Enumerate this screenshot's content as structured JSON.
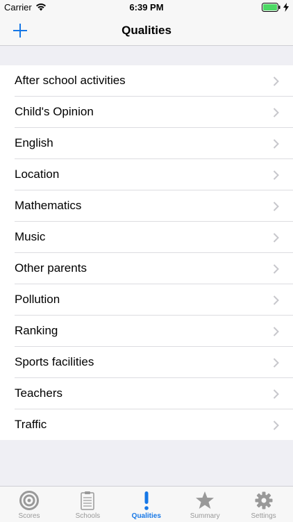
{
  "status_bar": {
    "carrier": "Carrier",
    "time": "6:39 PM"
  },
  "nav": {
    "title": "Qualities",
    "add_icon": "plus-icon"
  },
  "qualities": [
    {
      "label": "After school activities"
    },
    {
      "label": "Child's Opinion"
    },
    {
      "label": "English"
    },
    {
      "label": "Location"
    },
    {
      "label": "Mathematics"
    },
    {
      "label": "Music"
    },
    {
      "label": "Other parents"
    },
    {
      "label": "Pollution"
    },
    {
      "label": "Ranking"
    },
    {
      "label": "Sports facilities"
    },
    {
      "label": "Teachers"
    },
    {
      "label": "Traffic"
    }
  ],
  "tabs": [
    {
      "label": "Scores",
      "icon": "target-icon",
      "selected": false
    },
    {
      "label": "Schools",
      "icon": "clipboard-icon",
      "selected": false
    },
    {
      "label": "Qualities",
      "icon": "exclamation-icon",
      "selected": true
    },
    {
      "label": "Summary",
      "icon": "star-icon",
      "selected": false
    },
    {
      "label": "Settings",
      "icon": "gear-icon",
      "selected": false
    }
  ],
  "colors": {
    "accent": "#1677e6",
    "battery": "#4cd964",
    "inactive_tab": "#999999"
  }
}
